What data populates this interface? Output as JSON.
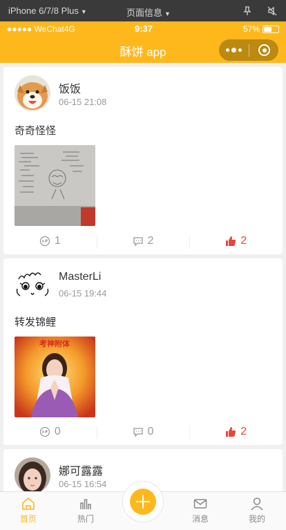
{
  "devtools": {
    "device": "iPhone 6/7/8 Plus",
    "page_info": "页面信息",
    "icons": [
      "pin-icon",
      "mute-icon"
    ]
  },
  "statusbar": {
    "carrier": "●●●●● WeChat4G",
    "time": "9:37",
    "battery": "57%",
    "battery_level": 0.57
  },
  "navbar": {
    "title": "酥饼 app",
    "capsule_icons": [
      "more-icon",
      "close-miniprogram-icon"
    ]
  },
  "posts": [
    {
      "user": "饭饭",
      "time": "06-15 21:08",
      "text": "奇奇怪怪",
      "avatar": "shiba-dog-avatar",
      "image": "sketch-notebook-photo",
      "views": "1",
      "comments": "2",
      "likes": "2",
      "liked": true
    },
    {
      "user": "MasterLi",
      "time": "06-15 19:44",
      "text": "转发锦鲤",
      "avatar": "doodle-face-avatar",
      "image": "girl-praying-poster",
      "image_caption": "考神附体",
      "views": "0",
      "comments": "0",
      "likes": "2",
      "liked": true
    },
    {
      "user": "娜可露露",
      "time": "06-15 16:54",
      "avatar": "girl-photo-avatar"
    }
  ],
  "tabbar": {
    "items": [
      {
        "label": "首页",
        "icon": "home-icon",
        "active": true
      },
      {
        "label": "热门",
        "icon": "bar-chart-icon",
        "active": false
      },
      {
        "label": "消息",
        "icon": "mail-icon",
        "active": false
      },
      {
        "label": "我的",
        "icon": "user-icon",
        "active": false
      }
    ],
    "fab_icon": "plus-icon"
  },
  "colors": {
    "accent": "#ffb81c",
    "like": "#e8453c",
    "muted": "#999999"
  }
}
